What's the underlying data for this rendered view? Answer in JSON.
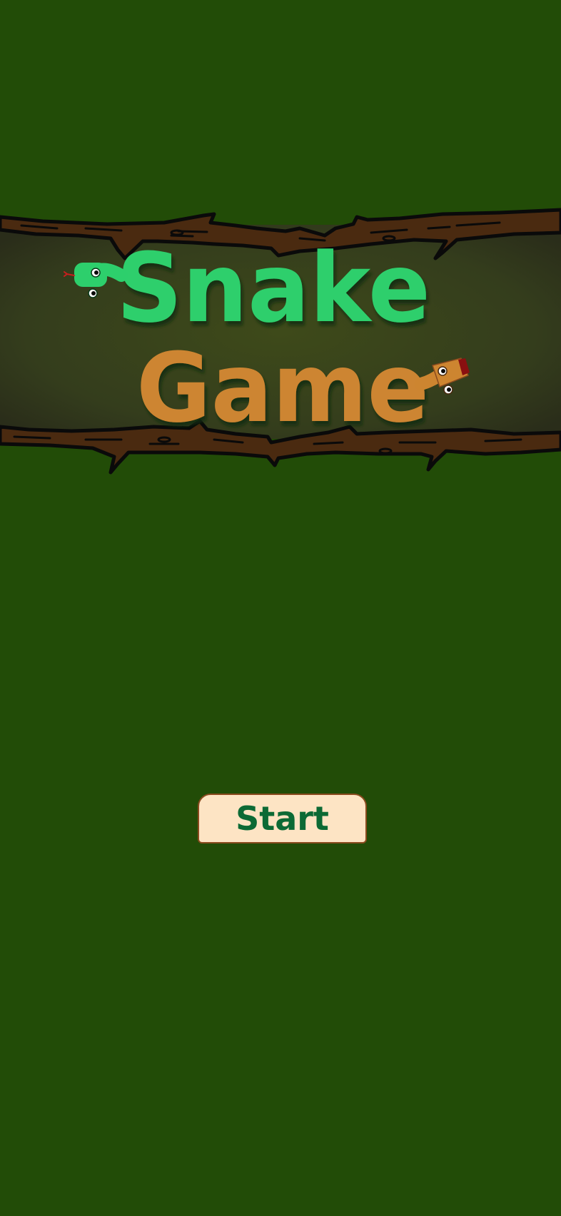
{
  "title": {
    "line1": "Snake",
    "line2": "Game"
  },
  "start_button": {
    "label": "Start"
  },
  "colors": {
    "background": "#224c07",
    "title_line1": "#2dcf6c",
    "title_line2": "#cd8530",
    "branch": "#4a2a10",
    "button_fill": "#fde4c4",
    "button_text": "#0c6a35"
  },
  "icons": [
    "green-snake-icon",
    "orange-snake-icon",
    "branch-icon"
  ]
}
